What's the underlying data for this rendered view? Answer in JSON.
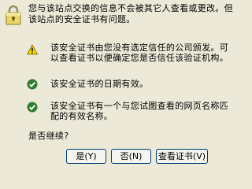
{
  "header": {
    "message": "您与该站点交换的信息不会被其它人查看或更改。但该站点的安全证书有问题。"
  },
  "items": [
    {
      "icon": "warning-icon",
      "text": "该安全证书由您没有选定信任的公司颁发。可以查看证书以便确定您是否信任该验证机构。"
    },
    {
      "icon": "check-icon",
      "text": "该安全证书的日期有效。"
    },
    {
      "icon": "check-icon",
      "text": "该安全证书有一个与您试图查看的网页名称匹配的有效名称。"
    }
  ],
  "prompt": "是否继续?",
  "buttons": {
    "yes": "是(Y)",
    "no": "否(N)",
    "view_cert": "查看证书(V)"
  },
  "colors": {
    "background": "#ece9d8",
    "warning": "#f5d400",
    "ok": "#2e7d32",
    "button_border": "#003c74"
  }
}
